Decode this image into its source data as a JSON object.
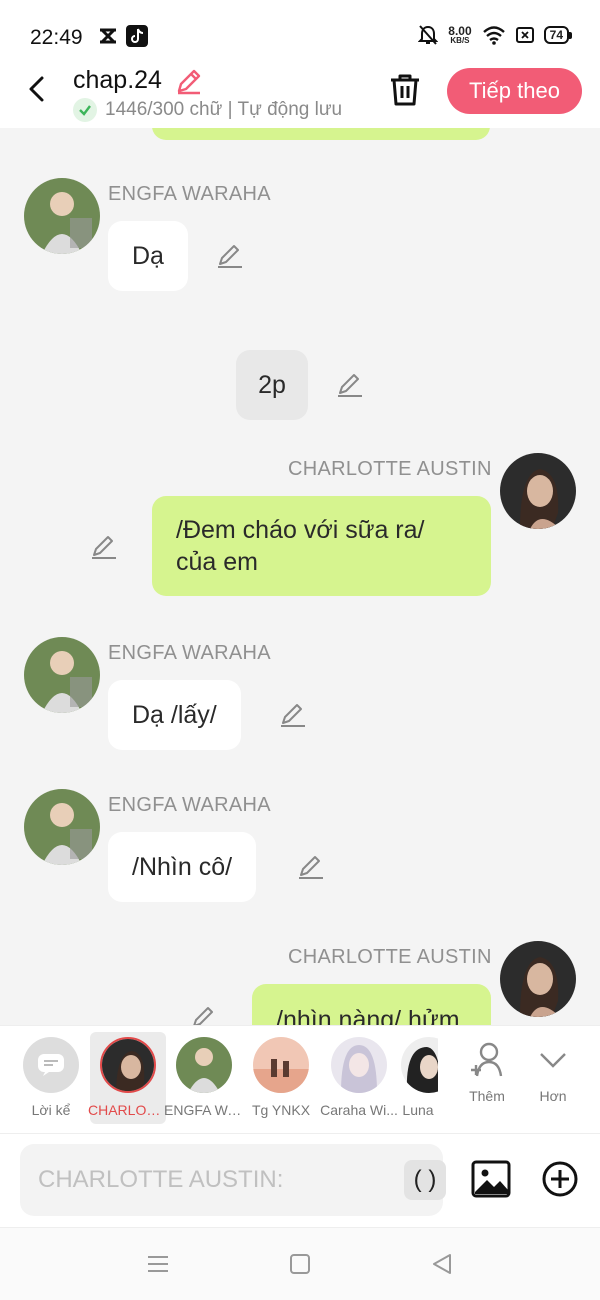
{
  "status": {
    "time": "22:49",
    "net_speed": "8.00",
    "net_unit": "KB/S",
    "battery": "74"
  },
  "header": {
    "title": "chap.24",
    "subtitle": "1446/300 chữ | Tự động lưu",
    "next_label": "Tiếp theo"
  },
  "chat": {
    "messages": [
      {
        "sender": "ENGFA WARAHA",
        "text": "Dạ"
      },
      {
        "sender": "",
        "text": "2p"
      },
      {
        "sender": "CHARLOTTE AUSTIN",
        "line1": "/Đem cháo với sữa ra/",
        "line2": "của em"
      },
      {
        "sender": "ENGFA WARAHA",
        "text": "Dạ /lấy/"
      },
      {
        "sender": "ENGFA WARAHA",
        "text": "/Nhìn cô/"
      },
      {
        "sender": "CHARLOTTE AUSTIN",
        "text": "/nhìn nàng/ hửm"
      }
    ]
  },
  "characters": [
    {
      "label": "Lời kể"
    },
    {
      "label": "CHARLOTTE AUSTIN"
    },
    {
      "label": "ENGFA WARAHA"
    },
    {
      "label": "Tg YNKX"
    },
    {
      "label": "Caraha Wi..."
    },
    {
      "label": "Luna"
    },
    {
      "label": "Thêm"
    },
    {
      "label": "Hơn"
    }
  ],
  "input": {
    "placeholder": "CHARLOTTE AUSTIN:",
    "paren_label": "( )"
  },
  "colors": {
    "accent": "#f25c76",
    "green_bubble": "#d6f48f",
    "selected": "#e24a4a"
  }
}
